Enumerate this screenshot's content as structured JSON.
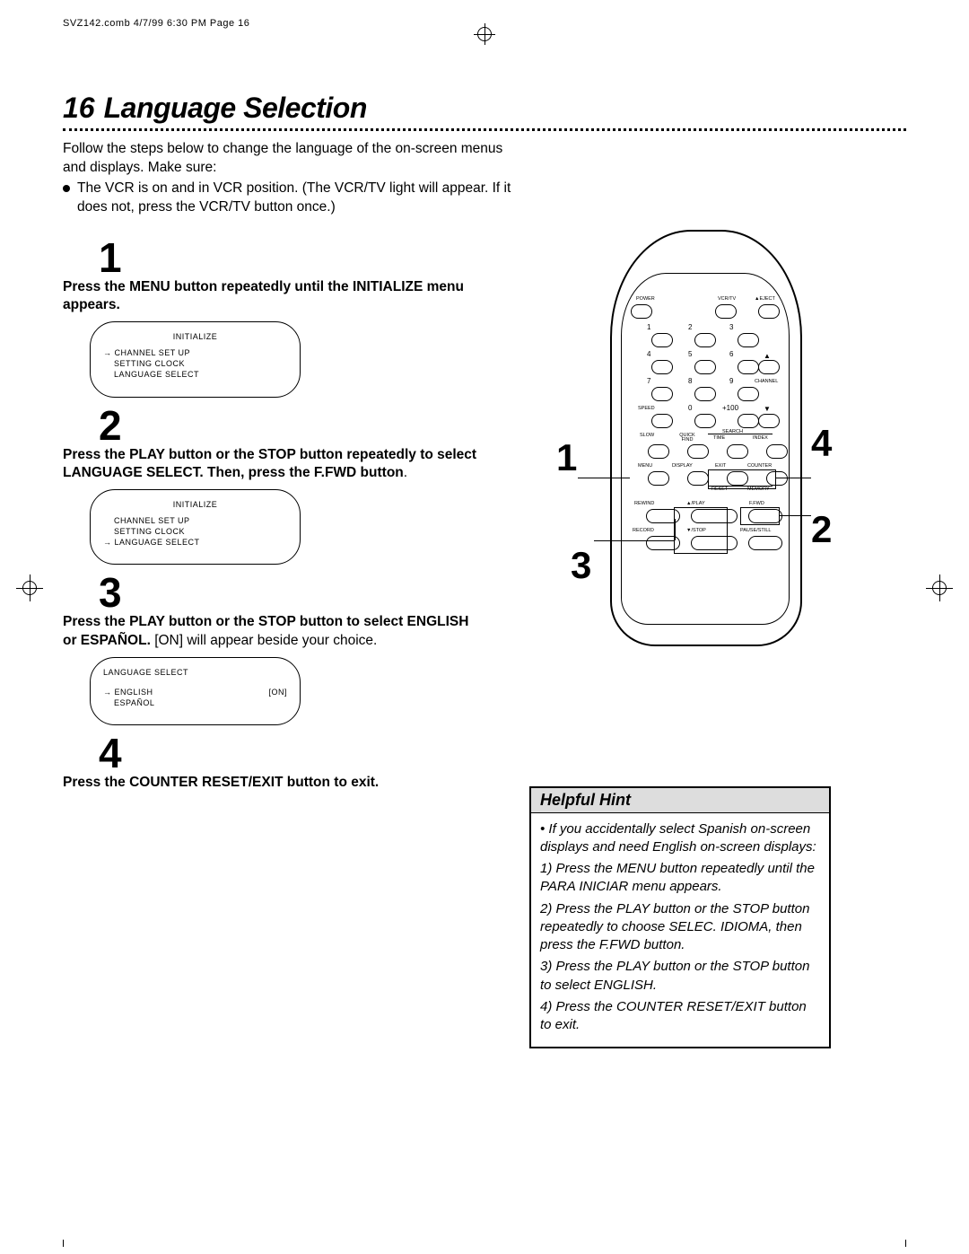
{
  "header": "SVZ142.comb  4/7/99  6:30 PM  Page 16",
  "page_number": "16",
  "page_title": "Language Selection",
  "intro_line1": "Follow the steps below to change the language of the on-screen menus and displays. Make sure:",
  "bullet": "The VCR is on and in VCR position. (The VCR/TV light will appear. If it does not, press the VCR/TV button once.)",
  "steps": {
    "s1": {
      "num": "1",
      "text": "Press the MENU button repeatedly until the INITIALIZE menu appears."
    },
    "s2": {
      "num": "2",
      "text_a": "Press the PLAY button or the STOP button repeatedly to select LANGUAGE SELECT. Then, press the F.FWD button",
      "text_b": "."
    },
    "s3": {
      "num": "3",
      "text_a": "Press the PLAY button or the STOP button to select ENGLISH or ESPAÑOL.",
      "text_b": " [ON] will appear beside your choice."
    },
    "s4": {
      "num": "4",
      "text": "Press the COUNTER RESET/EXIT button to exit."
    }
  },
  "osd1": {
    "title": "INITIALIZE",
    "l1": "CHANNEL SET UP",
    "l2": "SETTING CLOCK",
    "l3": "LANGUAGE SELECT"
  },
  "osd2": {
    "title": "INITIALIZE",
    "l1": "CHANNEL SET UP",
    "l2": "SETTING CLOCK",
    "l3": "LANGUAGE SELECT"
  },
  "osd3": {
    "title": "LANGUAGE SELECT",
    "l1": "ENGLISH",
    "l1r": "[ON]",
    "l2": "ESPAÑOL"
  },
  "remote": {
    "row1": {
      "a": "POWER",
      "b": "VCR/TV",
      "c": "▲EJECT"
    },
    "nums": [
      "1",
      "2",
      "3",
      "4",
      "5",
      "6",
      "7",
      "8",
      "9",
      "0",
      "+100"
    ],
    "channel": "CHANNEL",
    "speed": "SPEED",
    "slow": "SLOW",
    "quick": "QUICK FIND",
    "search": "SEARCH",
    "time": "TIME",
    "index": "INDEX",
    "menu": "MENU",
    "display": "DISPLAY",
    "exit": "EXIT",
    "counter": "COUNTER",
    "reset": "RESET",
    "memory": "MEMORY",
    "rewind": "REWIND",
    "play": "▲/PLAY",
    "ffwd": "F.FWD",
    "record": "RECORD",
    "stop": "▼/STOP",
    "pause": "PAUSE/STILL"
  },
  "callouts": {
    "c1": "1",
    "c2": "2",
    "c3": "3",
    "c4": "4"
  },
  "hint": {
    "title": "Helpful Hint",
    "p0": "• If you accidentally select Spanish on-screen displays and need English on-screen displays:",
    "p1": "1) Press the MENU button repeatedly until the PARA INICIAR menu appears.",
    "p2": "2) Press the PLAY button or the STOP button repeatedly to choose SELEC. IDIOMA, then press the F.FWD button.",
    "p3": "3) Press the PLAY button or the STOP button to select ENGLISH.",
    "p4": "4) Press the COUNTER RESET/EXIT button to exit."
  }
}
